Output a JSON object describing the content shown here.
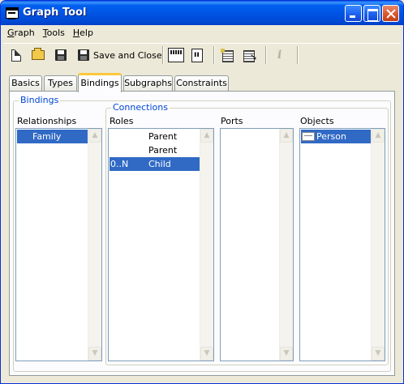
{
  "window": {
    "title": "Graph Tool"
  },
  "menu": [
    {
      "label": "Graph",
      "mnemonic": "G",
      "rest": "raph"
    },
    {
      "label": "Tools",
      "mnemonic": "T",
      "rest": "ools"
    },
    {
      "label": "Help",
      "mnemonic": "H",
      "rest": "elp"
    }
  ],
  "toolbar": {
    "save_close_label": "Save and Close",
    "icons": [
      "new-file-icon",
      "open-folder-icon",
      "save-icon",
      "save-close-icon",
      "merl-icon",
      "rb-icon",
      "list-icon",
      "select-icon",
      "info-icon"
    ]
  },
  "tabs": [
    "Basics",
    "Types",
    "Bindings",
    "Subgraphs",
    "Constraints"
  ],
  "active_tab": "Bindings",
  "bindings": {
    "group_title": "Bindings",
    "relationships_label": "Relationships",
    "relationships": [
      "Family"
    ],
    "connections": {
      "group_title": "Connections",
      "roles_label": "Roles",
      "roles": [
        {
          "multiplicity": "",
          "name": "Parent"
        },
        {
          "multiplicity": "",
          "name": "Parent"
        },
        {
          "multiplicity": "0..N",
          "name": "Child"
        }
      ],
      "ports_label": "Ports",
      "ports": [],
      "objects_label": "Objects",
      "objects": [
        "Person"
      ]
    }
  },
  "colors": {
    "title_bar": "#0055e5",
    "selection": "#316ac5",
    "group_title": "#0046d5",
    "active_tab_accent": "#ffc83c"
  }
}
